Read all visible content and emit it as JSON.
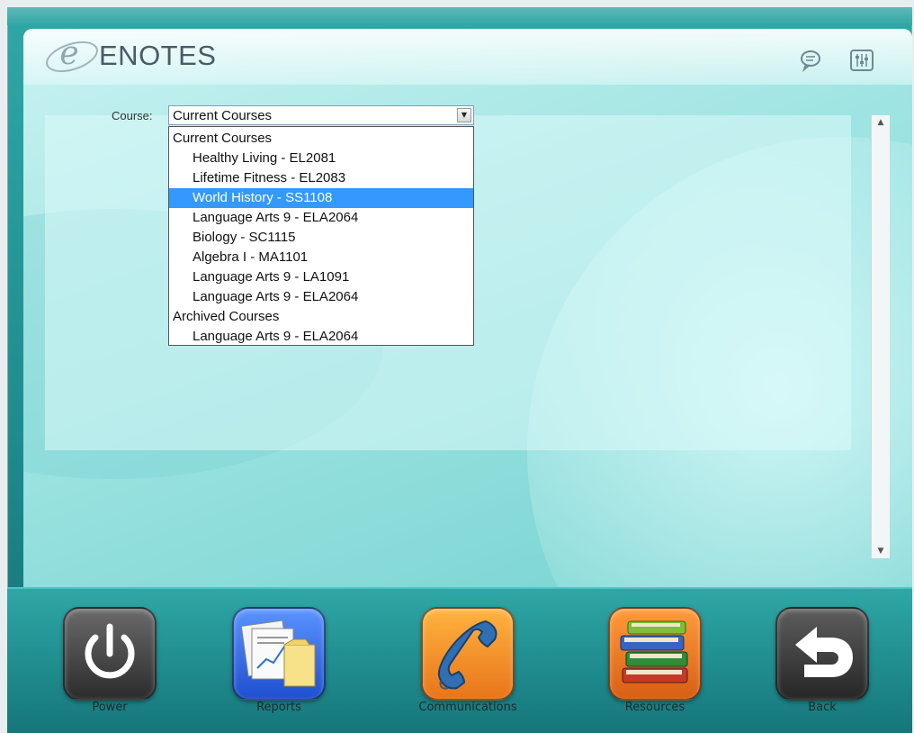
{
  "app": {
    "title": "ENOTES",
    "logo_icon": "e-logo-icon"
  },
  "header": {
    "icons": [
      "chat-icon",
      "settings-icon"
    ]
  },
  "course_selector": {
    "label": "Course:",
    "selected_value": "Current Courses",
    "options": [
      {
        "label": "Current Courses",
        "type": "group"
      },
      {
        "label": "Healthy Living - EL2081",
        "type": "item"
      },
      {
        "label": "Lifetime Fitness - EL2083",
        "type": "item"
      },
      {
        "label": "World History - SS1108",
        "type": "item",
        "highlighted": true
      },
      {
        "label": "Language Arts 9 - ELA2064",
        "type": "item"
      },
      {
        "label": "Biology - SC1115",
        "type": "item"
      },
      {
        "label": "Algebra I - MA1101",
        "type": "item"
      },
      {
        "label": "Language Arts 9 - LA1091",
        "type": "item"
      },
      {
        "label": "Language Arts 9 - ELA2064",
        "type": "item"
      },
      {
        "label": "Archived Courses",
        "type": "group"
      },
      {
        "label": "Language Arts 9 - ELA2064",
        "type": "item"
      }
    ]
  },
  "dock": {
    "power_label": "Power",
    "reports_label": "Reports",
    "communications_label": "Communications",
    "resources_label": "Resources",
    "back_label": "Back"
  },
  "colors": {
    "highlight": "#3399ff",
    "content_bg": "#9ee4e2",
    "dock_bg": "#218e90"
  }
}
